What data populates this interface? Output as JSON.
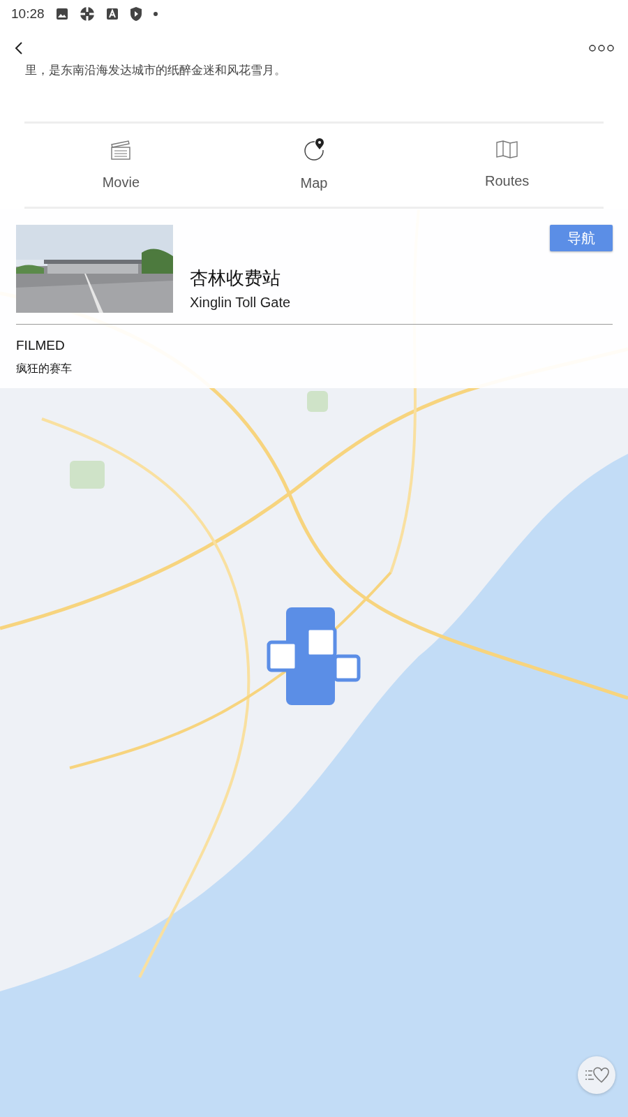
{
  "status_bar": {
    "time": "10:28"
  },
  "description": "里，是东南沿海发达城市的纸醉金迷和风花雪月。",
  "tabs": [
    {
      "label": "Movie",
      "kind": "movie"
    },
    {
      "label": "Map",
      "kind": "map"
    },
    {
      "label": "Routes",
      "kind": "routes"
    }
  ],
  "place": {
    "title": "杏林收费站",
    "subtitle": "Xinglin Toll Gate",
    "button": "导航",
    "section_label": "FILMED",
    "film": "疯狂的赛车"
  }
}
